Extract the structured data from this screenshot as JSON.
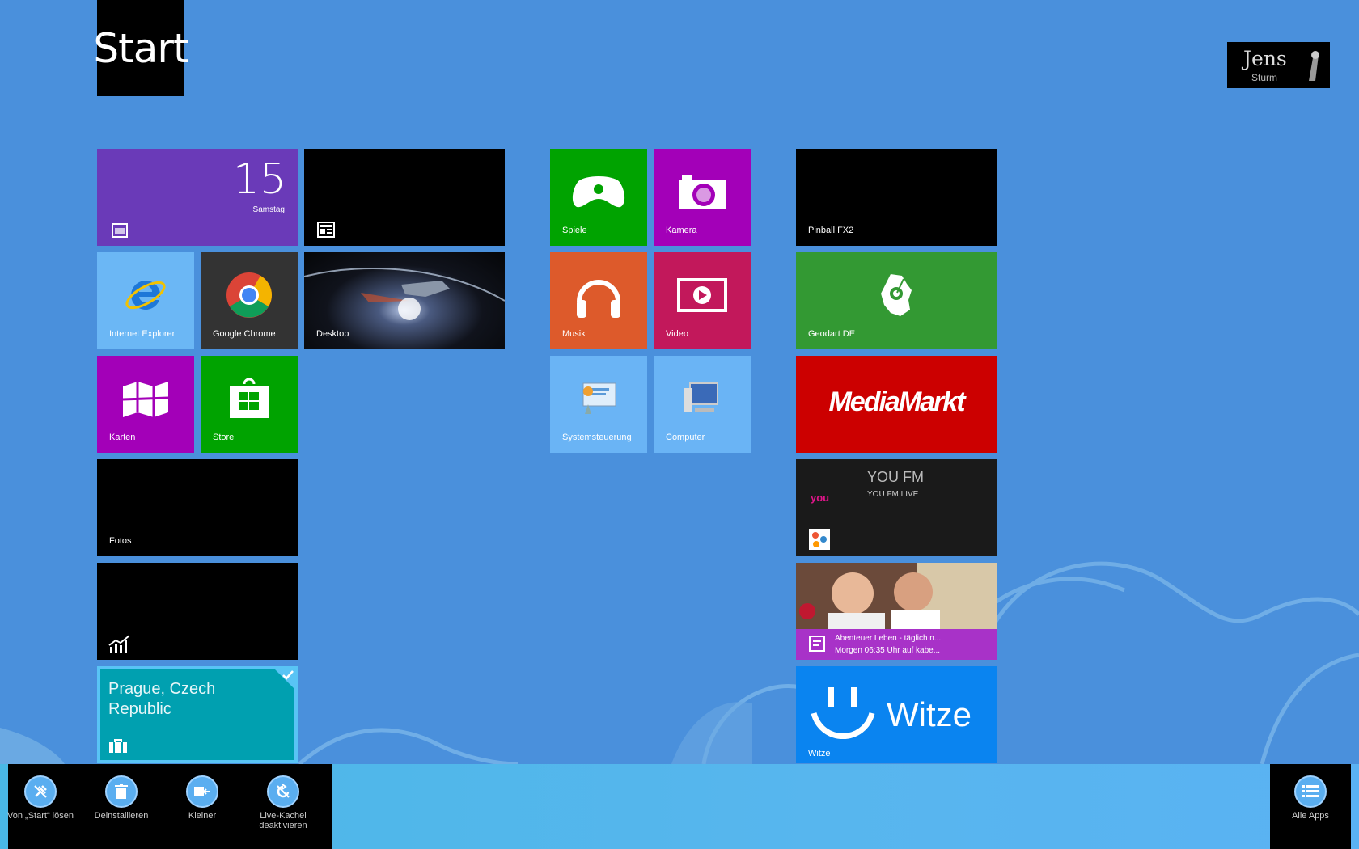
{
  "header": {
    "title": "Start",
    "user_first": "Jens",
    "user_last": "Sturm"
  },
  "tiles": {
    "calendar": {
      "day": "15",
      "weekday": "Samstag",
      "color": "#6a3ab8"
    },
    "news": {
      "color": "#000000"
    },
    "ie": {
      "label": "Internet Explorer",
      "color": "#6bb7f5"
    },
    "chrome": {
      "label": "Google Chrome",
      "color": "#333333"
    },
    "desktop": {
      "label": "Desktop"
    },
    "karten": {
      "label": "Karten",
      "color": "#a300b8"
    },
    "store": {
      "label": "Store",
      "color": "#00a300"
    },
    "fotos": {
      "label": "Fotos",
      "color": "#000000"
    },
    "finance": {
      "color": "#000000"
    },
    "weather": {
      "line1": "Prague, Czech",
      "line2": "Republic",
      "color": "#00a0b0"
    },
    "spiele": {
      "label": "Spiele",
      "color": "#00a300"
    },
    "kamera": {
      "label": "Kamera",
      "color": "#a300b8"
    },
    "musik": {
      "label": "Musik",
      "color": "#dd5a2b"
    },
    "video": {
      "label": "Video",
      "color": "#c2185b"
    },
    "systemsteuerung": {
      "label": "Systemsteuerung",
      "color": "#6ab4f5"
    },
    "computer": {
      "label": "Computer",
      "color": "#6ab4f5"
    },
    "pinball": {
      "label": "Pinball FX2",
      "color": "#000000"
    },
    "geodart": {
      "label": "Geodart DE",
      "color": "#339933"
    },
    "mediamarkt": {
      "label": "MediaMarkt",
      "color": "#cc0000"
    },
    "youfm": {
      "title": "YOU FM",
      "subtitle": "YOU FM LIVE",
      "brand": "you",
      "color": "#1a1a1a"
    },
    "tv": {
      "line1": "Abenteuer Leben - täglich n...",
      "line2": "Morgen 06:35 Uhr auf kabe...",
      "color": "#a832c8"
    },
    "witze": {
      "title": "Witze",
      "label": "Witze",
      "color": "#0a84f0"
    }
  },
  "appbar": {
    "commands": [
      {
        "label": "Von „Start“ lösen",
        "icon": "unpin-icon"
      },
      {
        "label": "Deinstallieren",
        "icon": "trash-icon"
      },
      {
        "label": "Kleiner",
        "icon": "smaller-icon"
      },
      {
        "label": "Live-Kachel deaktivieren",
        "icon": "live-tile-off-icon"
      }
    ],
    "all_apps": "Alle Apps"
  }
}
